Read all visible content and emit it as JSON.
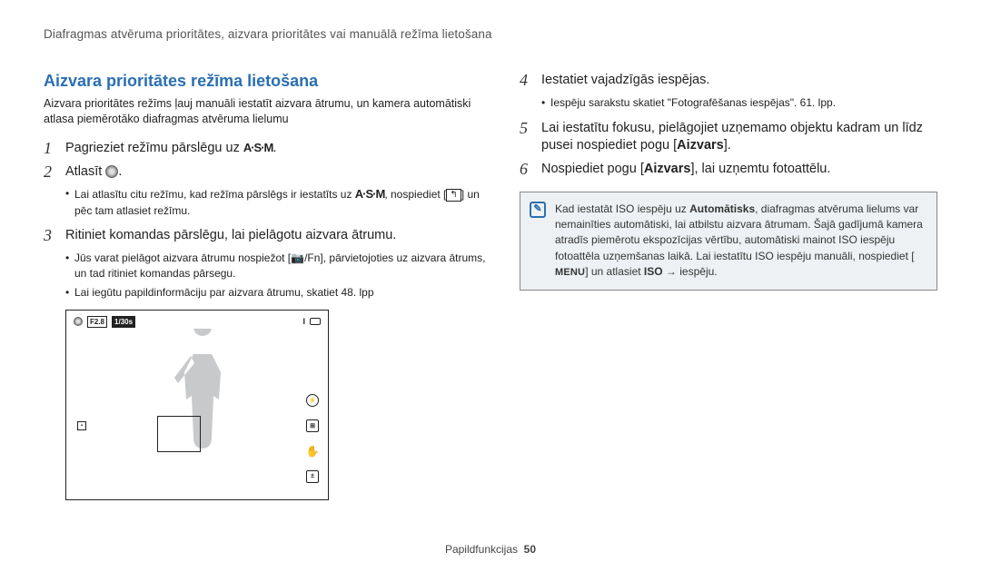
{
  "header": "Diafragmas atvēruma prioritātes, aizvara prioritātes vai manuālā režīma lietošana",
  "section": {
    "title": "Aizvara prioritātes režīma lietošana",
    "intro": "Aizvara prioritātes režīms ļauj manuāli iestatīt aizvara ātrumu, un kamera automātiski atlasa piemērotāko diafragmas atvēruma lielumu"
  },
  "modeGlyph": "A·S·M",
  "steps_left": [
    {
      "num": "1",
      "text_pre": "Pagrieziet režīmu pārslēgu uz ",
      "text_post": "."
    },
    {
      "num": "2",
      "text_pre": "Atlasīt ",
      "text_post": "."
    },
    {
      "num": "3",
      "text_pre": "Ritiniet komandas pārslēgu, lai pielāgotu aizvara ātrumu."
    }
  ],
  "left_sub_a": [
    "Lai atlasītu citu režīmu, kad režīma pārslēgs ir iestatīts uz ",
    ", nospiediet [",
    "] un pēc tam atlasiet režīmu."
  ],
  "left_sub_b": [
    "Jūs varat pielāgot aizvara ātrumu nospiežot [",
    "], pārvietojoties uz aizvara ātrums, un tad ritiniet komandas pārsegu.",
    "Lai iegūtu papildinformāciju par aizvara ātrumu, skatiet 48. lpp"
  ],
  "fn_icons": "📷/Fn",
  "back_icon": "↰",
  "steps_right": [
    {
      "num": "4",
      "text": "Iestatiet vajadzīgās iespējas."
    },
    {
      "num": "5",
      "text_pre": "Lai iestatītu fokusu, pielāgojiet uzņemamo objektu kadram un līdz pusei nospiediet pogu [",
      "bold": "Aizvars",
      "text_post": "]."
    },
    {
      "num": "6",
      "text_pre": "Nospiediet pogu [",
      "bold": "Aizvars",
      "text_post": "], lai uzņemtu fotoattēlu."
    }
  ],
  "right_sub_4": "Iespēju sarakstu skatiet \"Fotografēšanas iespējas\". 61. lpp.",
  "info_box": {
    "text_pre": "Kad iestatāt ISO iespēju uz ",
    "bold1": "Automātisks",
    "text_mid": ", diafragmas atvēruma lielums var nemainīties automātiski, lai atbilstu aizvara ātrumam. Šajā gadījumā kamera atradīs piemērotu ekspozīcijas vērtību, automātiski mainot ISO iespēju fotoattēla uzņemšanas laikā. Lai iestatītu ISO iespēju manuāli, nospiediet [",
    "menu": "MENU",
    "text_post": "] un atlasiet ",
    "bold2": "ISO",
    "text_end": " → iespēju."
  },
  "camera_panel": {
    "aperture": "F2.8",
    "shutter": "1/30s"
  },
  "footer": {
    "label": "Papildfunkcijas",
    "page": "50"
  }
}
